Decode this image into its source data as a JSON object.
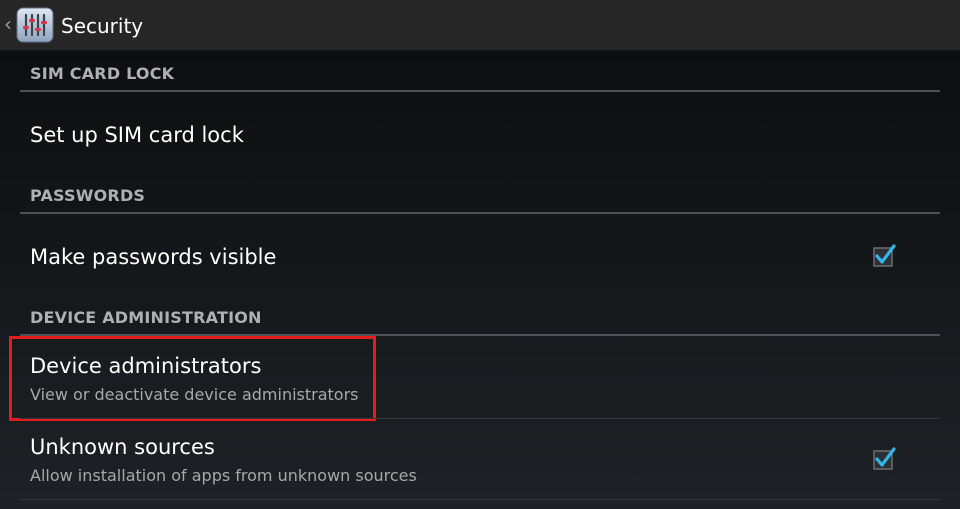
{
  "action_bar": {
    "title": "Security",
    "back_glyph": "‹",
    "icon": "settings-sliders-icon"
  },
  "sections": [
    {
      "header": "SIM CARD LOCK",
      "items": [
        {
          "title": "Set up SIM card lock"
        }
      ]
    },
    {
      "header": "PASSWORDS",
      "items": [
        {
          "title": "Make passwords visible",
          "checked": true
        }
      ]
    },
    {
      "header": "DEVICE ADMINISTRATION",
      "items": [
        {
          "title": "Device administrators",
          "summary": "View or deactivate device administrators",
          "highlighted": true
        },
        {
          "title": "Unknown sources",
          "summary": "Allow installation of apps from unknown sources",
          "checked": true
        }
      ]
    }
  ],
  "colors": {
    "accent": "#33b5e5",
    "highlight": "#e41c1c",
    "action_bar": "#262626",
    "header_text": "#aeb0b2"
  }
}
